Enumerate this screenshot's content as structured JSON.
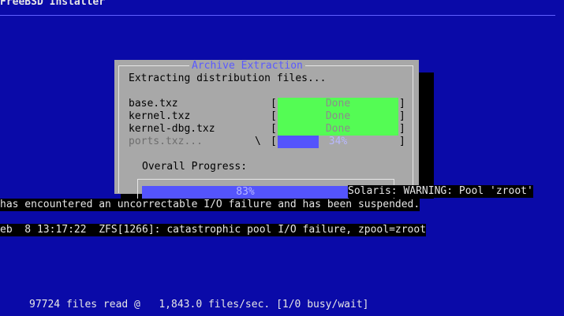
{
  "installer": {
    "title": "FreeBSD Installer"
  },
  "dialog": {
    "title": "Archive Extraction",
    "message": "Extracting distribution files...",
    "files": [
      {
        "name": "base.txz",
        "status": "Done"
      },
      {
        "name": "kernel.txz",
        "status": "Done"
      },
      {
        "name": "kernel-dbg.txz",
        "status": "Done"
      },
      {
        "name": "ports.txz...",
        "spinner": "\\",
        "status": "34%",
        "progress": 0.34
      }
    ],
    "overall_label": "Overall Progress:",
    "overall_percent": "83%",
    "overall_progress": 0.83
  },
  "console": {
    "line1": "Solaris: WARNING: Pool 'zroot'",
    "line2": "has encountered an uncorrectable I/O failure and has been suspended.",
    "line3": "eb  8 13:17:22  ZFS[1266]: catastrophic pool I/O failure, zpool=zroot"
  },
  "status_line": "97724 files read @   1,843.0 files/sec. [1/0 busy/wait]",
  "colors": {
    "background": "#0a0aa8",
    "dialog": "#a8a8a8",
    "done_bar": "#54fc54",
    "progress_bar": "#5454fc"
  }
}
